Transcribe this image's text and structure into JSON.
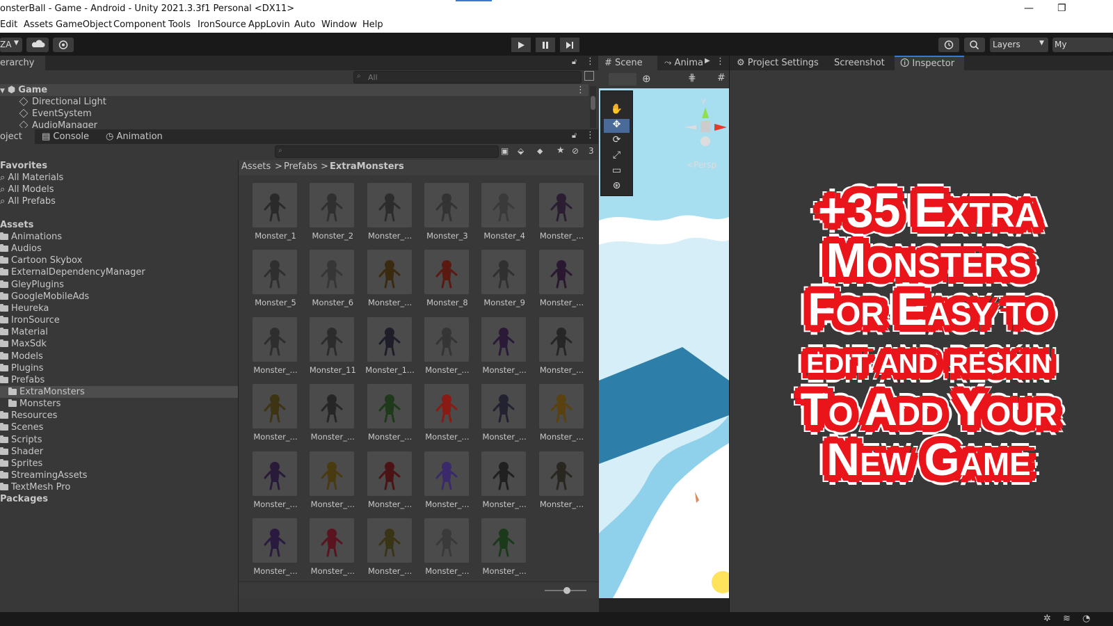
{
  "window": {
    "title": "onsterBall - Game - Android - Unity 2021.3.3f1 Personal <DX11>",
    "minimize": "—",
    "restore": "❐"
  },
  "menu": [
    "Edit",
    "Assets",
    "GameObject",
    "Component",
    "Tools",
    "IronSource",
    "AppLovin",
    "Auto",
    "Window",
    "Help"
  ],
  "toolbar": {
    "account": "ZA",
    "layers": "Layers",
    "layout": "My"
  },
  "hierarchy": {
    "tab": "erarchy",
    "search_placeholder": "All",
    "scene": "Game",
    "items": [
      "Directional Light",
      "EventSystem",
      "AudioManager"
    ]
  },
  "project": {
    "tabs": [
      "oject",
      "Console",
      "Animation"
    ],
    "hidden_count": "3",
    "favorites_header": "Favorites",
    "favorites": [
      "All Materials",
      "All Models",
      "All Prefabs"
    ],
    "assets_header": "Assets",
    "folders": [
      "Animations",
      "Audios",
      "Cartoon Skybox",
      "ExternalDependencyManager",
      "GleyPlugins",
      "GoogleMobileAds",
      "Heureka",
      "IronSource",
      "Material",
      "MaxSdk",
      "Models",
      "Plugins",
      "Prefabs",
      "ExtraMonsters",
      "Monsters",
      "Resources",
      "Scenes",
      "Scripts",
      "Shader",
      "Sprites",
      "StreamingAssets",
      "TextMesh Pro"
    ],
    "packages_header": "Packages",
    "breadcrumb": [
      "Assets",
      "Prefabs",
      "ExtraMonsters"
    ],
    "breadcrumb_sep": ">",
    "assets": [
      {
        "label": "Monster_1",
        "color": "#2a2a2a"
      },
      {
        "label": "Monster_2",
        "color": "#303030"
      },
      {
        "label": "Monster_...",
        "color": "#2c2c2c"
      },
      {
        "label": "Monster_3",
        "color": "#333333"
      },
      {
        "label": "Monster_4",
        "color": "#3a3a3a"
      },
      {
        "label": "Monster_...",
        "color": "#2b1e33"
      },
      {
        "label": "Monster_5",
        "color": "#2f2f2f"
      },
      {
        "label": "Monster_6",
        "color": "#363636"
      },
      {
        "label": "Monster_...",
        "color": "#3a2a10"
      },
      {
        "label": "Monster_8",
        "color": "#5a1a12"
      },
      {
        "label": "Monster_9",
        "color": "#303030"
      },
      {
        "label": "Monster_...",
        "color": "#2a1830"
      },
      {
        "label": "Monster_...",
        "color": "#2e2e2e"
      },
      {
        "label": "Monster_11",
        "color": "#2c2c2c"
      },
      {
        "label": "Monster_1...",
        "color": "#1e1e2a"
      },
      {
        "label": "Monster_...",
        "color": "#353535"
      },
      {
        "label": "Monster_...",
        "color": "#2a1a38"
      },
      {
        "label": "Monster_...",
        "color": "#262626"
      },
      {
        "label": "Monster_...",
        "color": "#3d3414"
      },
      {
        "label": "Monster_...",
        "color": "#262626"
      },
      {
        "label": "Monster_...",
        "color": "#1e3a1a"
      },
      {
        "label": "Monster_...",
        "color": "#8a1a14"
      },
      {
        "label": "Monster_...",
        "color": "#222230"
      },
      {
        "label": "Monster_...",
        "color": "#5a4210"
      },
      {
        "label": "Monster_...",
        "color": "#2a1a3a"
      },
      {
        "label": "Monster_...",
        "color": "#4a3a10"
      },
      {
        "label": "Monster_...",
        "color": "#4a1414"
      },
      {
        "label": "Monster_...",
        "color": "#3a2a6a"
      },
      {
        "label": "Monster_...",
        "color": "#202020"
      },
      {
        "label": "Monster_...",
        "color": "#2a2620"
      },
      {
        "label": "Monster_...",
        "color": "#2a1a40"
      },
      {
        "label": "Monster_...",
        "color": "#5a1420"
      },
      {
        "label": "Monster_...",
        "color": "#3a3416"
      },
      {
        "label": "Monster_...",
        "color": "#3a3a3a"
      },
      {
        "label": "Monster_...",
        "color": "#1a3a1a"
      }
    ]
  },
  "scene": {
    "tabs": [
      "Scene",
      "Anima"
    ],
    "gizmo_axis": "y",
    "persp": "Persp"
  },
  "right_tabs": [
    "Project Settings",
    "Screenshot",
    "Inspector"
  ],
  "promo": {
    "lines": [
      "+35 Extra",
      "Monsters",
      "For Easy to",
      "edit and reskin",
      "To Add Your",
      "New Game"
    ],
    "fill_color": "#ffffff",
    "outline_color": "#e9151b"
  }
}
